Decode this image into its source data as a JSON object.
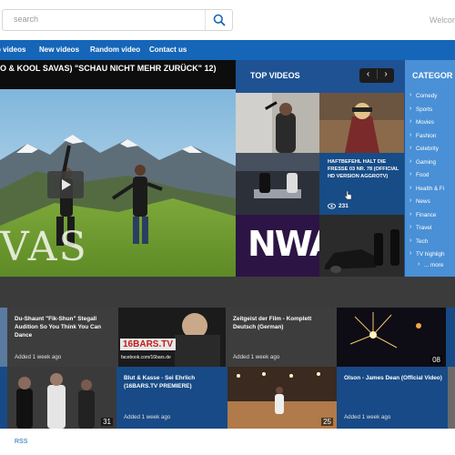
{
  "search": {
    "placeholder": "search"
  },
  "header": {
    "welcome": "Welcom"
  },
  "nav": {
    "items": [
      "p videos",
      "New videos",
      "Random video",
      "Contact us"
    ]
  },
  "player": {
    "title": "O & KOOL SAVAS) \"SCHAU NICHT MEHR ZURÜCK\" 12)",
    "watermark": "VAS"
  },
  "top_videos": {
    "heading": "TOP VIDEOS",
    "prev": "‹",
    "next": "›",
    "featured": {
      "title": "HAFTBEFEHL HALT DIE FRESSE 03 NR. 78 (OFFICIAL HD VERSION AGGROTV)",
      "views": "231"
    },
    "nwa_text": "NWA"
  },
  "categories": {
    "heading": "CATEGOR",
    "items": [
      "Comedy",
      "Sports",
      "Movies",
      "Fashion",
      "Celebrity",
      "Gaming",
      "Food",
      "Health & Fi",
      "News",
      "Finance",
      "Travel",
      "Tech",
      "TV highligh"
    ],
    "more": "... more"
  },
  "row1": [
    {
      "title": "Du-Shaunt \"Fik-Shun\" Stegall Audition So You Think You Can Dance",
      "added": "Added 1 week ago"
    },
    {
      "title": "Zeitgeist der Film - Komplett Deutsch (German)",
      "added": "Added 1 week ago"
    }
  ],
  "row1_thumbs": {
    "banner": "16BARS.TV",
    "banner_sub": "facebook.com/16bars.de",
    "dur": "08"
  },
  "row2": [
    {
      "title": "Blut & Kasse - Sei Ehrlich (16BARS.TV PREMIERE)",
      "added": "Added 1 week ago"
    },
    {
      "title": "Olson - James Dean (Official Video)",
      "added": "Added 1 week ago"
    }
  ],
  "row2_thumbs": {
    "dur1": "31",
    "dur2": "25"
  },
  "footer": {
    "rss": "RSS"
  }
}
